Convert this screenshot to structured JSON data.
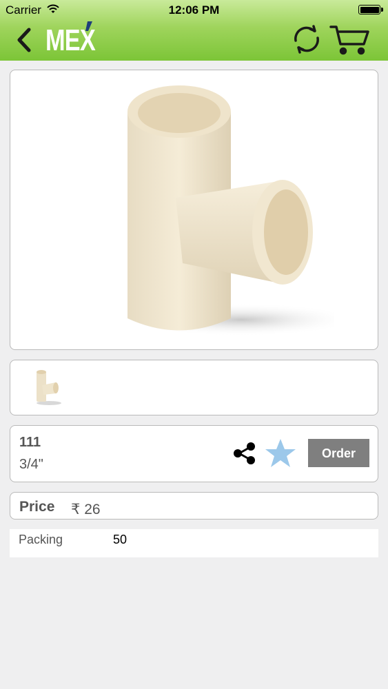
{
  "status_bar": {
    "carrier": "Carrier",
    "time": "12:06 PM"
  },
  "header": {
    "logo": "MEX",
    "back_icon": "chevron-left-icon",
    "refresh_icon": "refresh-icon",
    "cart_icon": "cart-icon",
    "gradient_colors": [
      "#c9ea9a",
      "#7cc537"
    ]
  },
  "product": {
    "code": "111",
    "size": "3/4\"",
    "order_label": "Order",
    "share_icon": "share-icon",
    "favorite_icon": "star-icon",
    "favorite_color": "#9cc8ea",
    "order_button_color": "#7f7f7f"
  },
  "price": {
    "label": "Price",
    "value": "₹ 26"
  },
  "details": [
    {
      "label": "Packing",
      "value": "50"
    }
  ]
}
